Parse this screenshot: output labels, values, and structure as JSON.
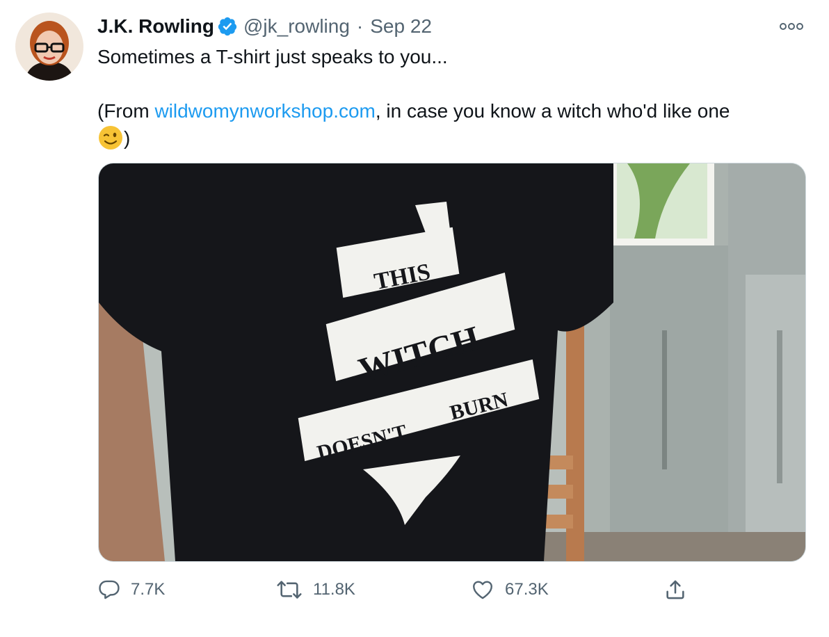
{
  "tweet": {
    "author_name": "J.K. Rowling",
    "handle": "@jk_rowling",
    "separator": "·",
    "date": "Sep 22",
    "text_line1": "Sometimes a T-shirt just speaks to you...",
    "text_line2_prefix": "(From ",
    "link_text": "wildwomynworkshop.com",
    "text_line2_suffix": ", in case you know a witch who'd like one",
    "text_after_emoji": ")",
    "emoji": "winking-face"
  },
  "media": {
    "shirt_text": [
      "THIS",
      "WITCH",
      "DOESN'T",
      "BURN"
    ]
  },
  "actions": {
    "replies": "7.7K",
    "retweets": "11.8K",
    "likes": "67.3K"
  },
  "colors": {
    "text": "#0f1419",
    "secondary": "#536471",
    "link": "#1d9bf0",
    "verified": "#1d9bf0",
    "border": "#cfd9de"
  },
  "icons": [
    "verified-badge-icon",
    "more-options-icon",
    "reply-icon",
    "retweet-icon",
    "like-icon",
    "share-icon"
  ]
}
